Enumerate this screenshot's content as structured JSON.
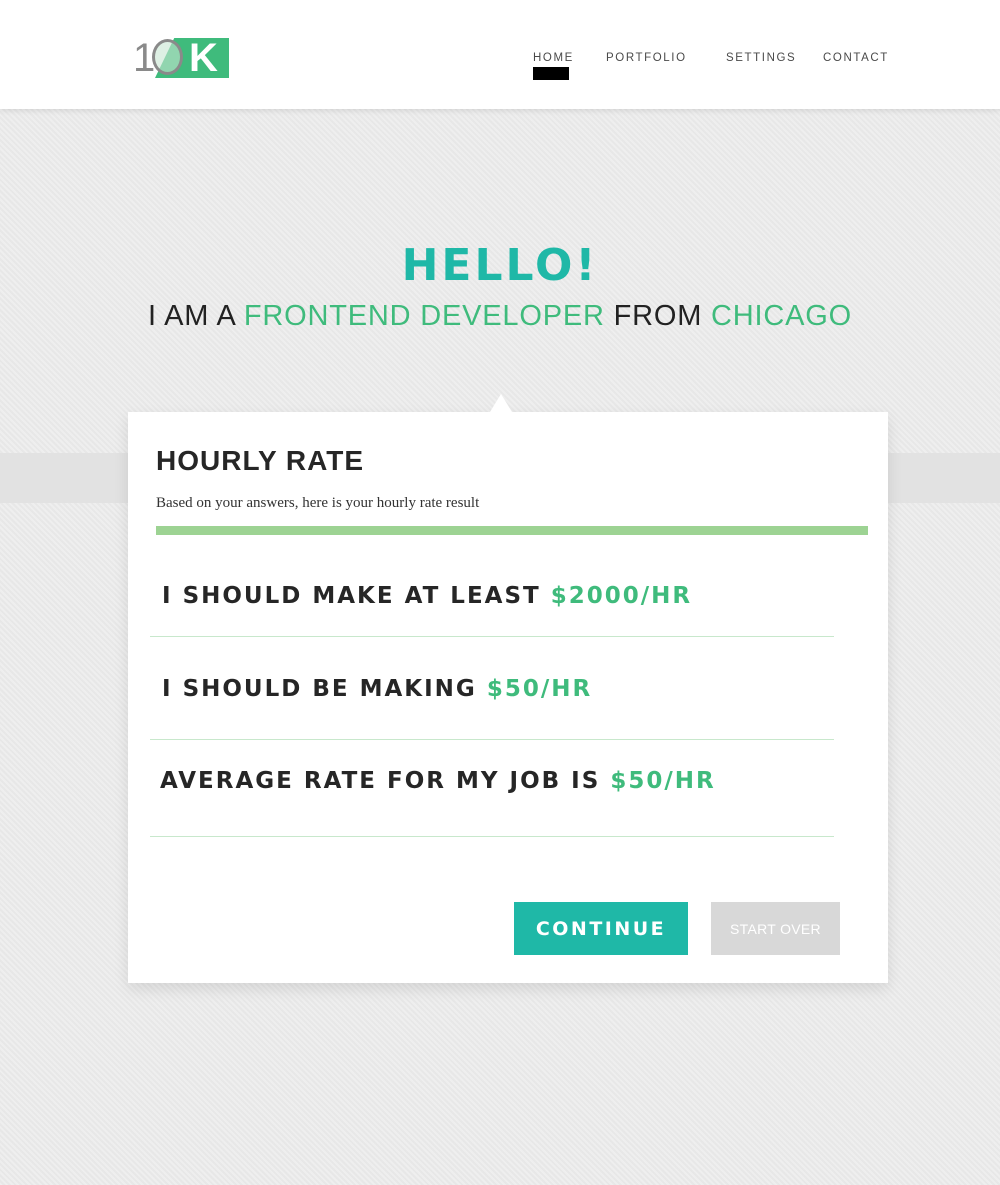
{
  "logo": {
    "digit": "1",
    "letter": "K",
    "brand_color": "#3fbb7c"
  },
  "nav": {
    "items": [
      "HOME",
      "PORTFOLIO",
      "SETTINGS",
      "CONTACT"
    ],
    "active": "HOME"
  },
  "hero": {
    "title": "HELLO!",
    "sub_prefix": "I AM A ",
    "role": "FRONTEND DEVELOPER",
    "sub_mid": " FROM ",
    "city": "CHICAGO"
  },
  "card": {
    "title": "HOURLY RATE",
    "description": "Based on your answers, here is your hourly rate result",
    "progress": 1.0,
    "results": [
      {
        "label": "I SHOULD MAKE AT LEAST ",
        "amount": "$2000/HR"
      },
      {
        "label": "I SHOULD BE MAKING ",
        "amount": "$50/HR"
      },
      {
        "label": "AVERAGE RATE FOR MY JOB IS ",
        "amount": "$50/HR"
      }
    ],
    "continue_label": "CONTINUE",
    "start_over_label": "START OVER"
  },
  "colors": {
    "teal": "#1fb8a7",
    "green": "#3fbb7c",
    "progress_green": "#9dd393",
    "background": "#ececec"
  }
}
